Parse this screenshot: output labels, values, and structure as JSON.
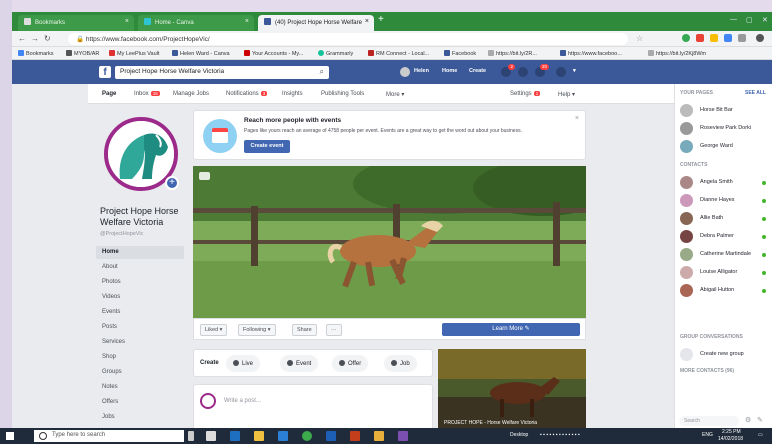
{
  "browser": {
    "tabs": [
      {
        "label": "Bookmarks",
        "active": false
      },
      {
        "label": "Home - Canva",
        "active": false
      },
      {
        "label": "(40) Project Hope Horse Welfare",
        "active": true
      }
    ],
    "url": "https://www.facebook.com/ProjectHopeVic/",
    "bookmarks": [
      "Bookmarks",
      "MYOB/AR",
      "My LeePlus Vault",
      "Helen Ward - Canva",
      "Your Accounts - My...",
      "Grammarly",
      "RM Connect - Local...",
      "Facebook",
      "https://bit.ly/2R...",
      "https://www.faceboo...",
      "https://bit.ly/2Kj8Wm"
    ]
  },
  "facebook": {
    "search_value": "Project Hope Horse Welfare Victoria",
    "topnav": {
      "user": "Helen",
      "home": "Home",
      "create": "Create",
      "friend_badge": "2",
      "notif_badge": "20"
    },
    "page_tabs": [
      {
        "label": "Page",
        "active": true,
        "badge": ""
      },
      {
        "label": "Inbox",
        "active": false,
        "badge": "15"
      },
      {
        "label": "Manage Jobs",
        "active": false,
        "badge": ""
      },
      {
        "label": "Notifications",
        "active": false,
        "badge": "3"
      },
      {
        "label": "Insights",
        "active": false,
        "badge": ""
      },
      {
        "label": "Publishing Tools",
        "active": false,
        "badge": ""
      },
      {
        "label": "More ▾",
        "active": false,
        "badge": ""
      },
      {
        "label": "Settings",
        "active": false,
        "badge": "1"
      },
      {
        "label": "Help ▾",
        "active": false,
        "badge": ""
      }
    ],
    "page": {
      "name": "Project Hope Horse Welfare Victoria",
      "handle": "@ProjectHopeVic",
      "nav": [
        "Home",
        "About",
        "Photos",
        "Videos",
        "Events",
        "Posts",
        "Services",
        "Shop",
        "Groups",
        "Notes",
        "Offers",
        "Jobs"
      ]
    },
    "promo": {
      "title": "Reach more people with events",
      "text": "Pages like yours reach an average of 4758 people per event. Events are a great way to get the word out about your business.",
      "button": "Create event"
    },
    "actions": {
      "liked": "Liked ▾",
      "following": "Following ▾",
      "share": "Share",
      "more": "···",
      "learn_more": "Learn More ✎"
    },
    "create": {
      "label": "Create",
      "buttons": [
        "Live",
        "Event",
        "Offer",
        "Job"
      ]
    },
    "write_post_placeholder": "Write a post...",
    "video_caption": "PROJECT HOPE - Horse Welfare Victoria"
  },
  "chat": {
    "your_pages_label": "YOUR PAGES",
    "see_all": "SEE ALL",
    "pages": [
      "Horse Bit Bar",
      "Roseview Park Dorki",
      "George Ward"
    ],
    "contacts_label": "CONTACTS",
    "contacts": [
      "Angela Smith",
      "Dianne Hayes",
      "Allie Bath",
      "Debra Palmer",
      "Catherine Martindale",
      "Louise Alligator",
      "Abigail Hutton"
    ],
    "group_label": "GROUP CONVERSATIONS",
    "create_group": "Create new group",
    "more_contacts_label": "MORE CONTACTS (96)",
    "search_placeholder": "Search"
  },
  "taskbar": {
    "search_placeholder": "Type here to search",
    "desktop": "Desktop",
    "time": "2:25 PM",
    "date": "14/02/2018",
    "lang": "ENG"
  }
}
